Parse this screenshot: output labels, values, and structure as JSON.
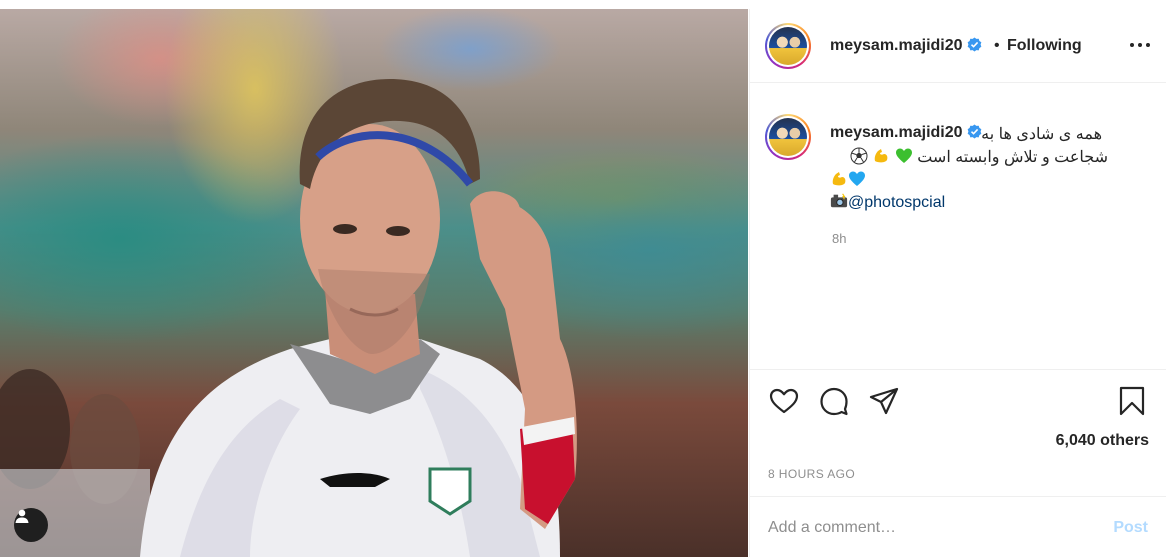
{
  "header": {
    "username": "meysam.majidi20",
    "verified": true,
    "separator": "•",
    "follow_status": "Following",
    "more_icon": "more-horizontal-icon"
  },
  "caption": {
    "username": "meysam.majidi20",
    "line1": "همه ی شادی ها به",
    "line2": "شجاعت و تلاش وابسته است",
    "line2_emojis": [
      "soccer-ball",
      "flexed-biceps",
      "green-heart"
    ],
    "line3_emojis": [
      "flexed-biceps",
      "blue-heart"
    ],
    "line4_icon": "camera-with-flash",
    "mention": "@photospcial",
    "time_ago": "8h"
  },
  "actions": {
    "like_icon": "heart-icon",
    "comment_icon": "comment-icon",
    "share_icon": "paper-plane-icon",
    "save_icon": "bookmark-icon"
  },
  "likes": {
    "text": "6,040 others"
  },
  "posted_time": "8 HOURS AGO",
  "comment_box": {
    "placeholder": "Add a comment…",
    "post_label": "Post"
  },
  "colors": {
    "verified": "#3897f0",
    "post_disabled": "#b3dbff",
    "mention": "#00376b",
    "muted": "#8e8e8e"
  }
}
